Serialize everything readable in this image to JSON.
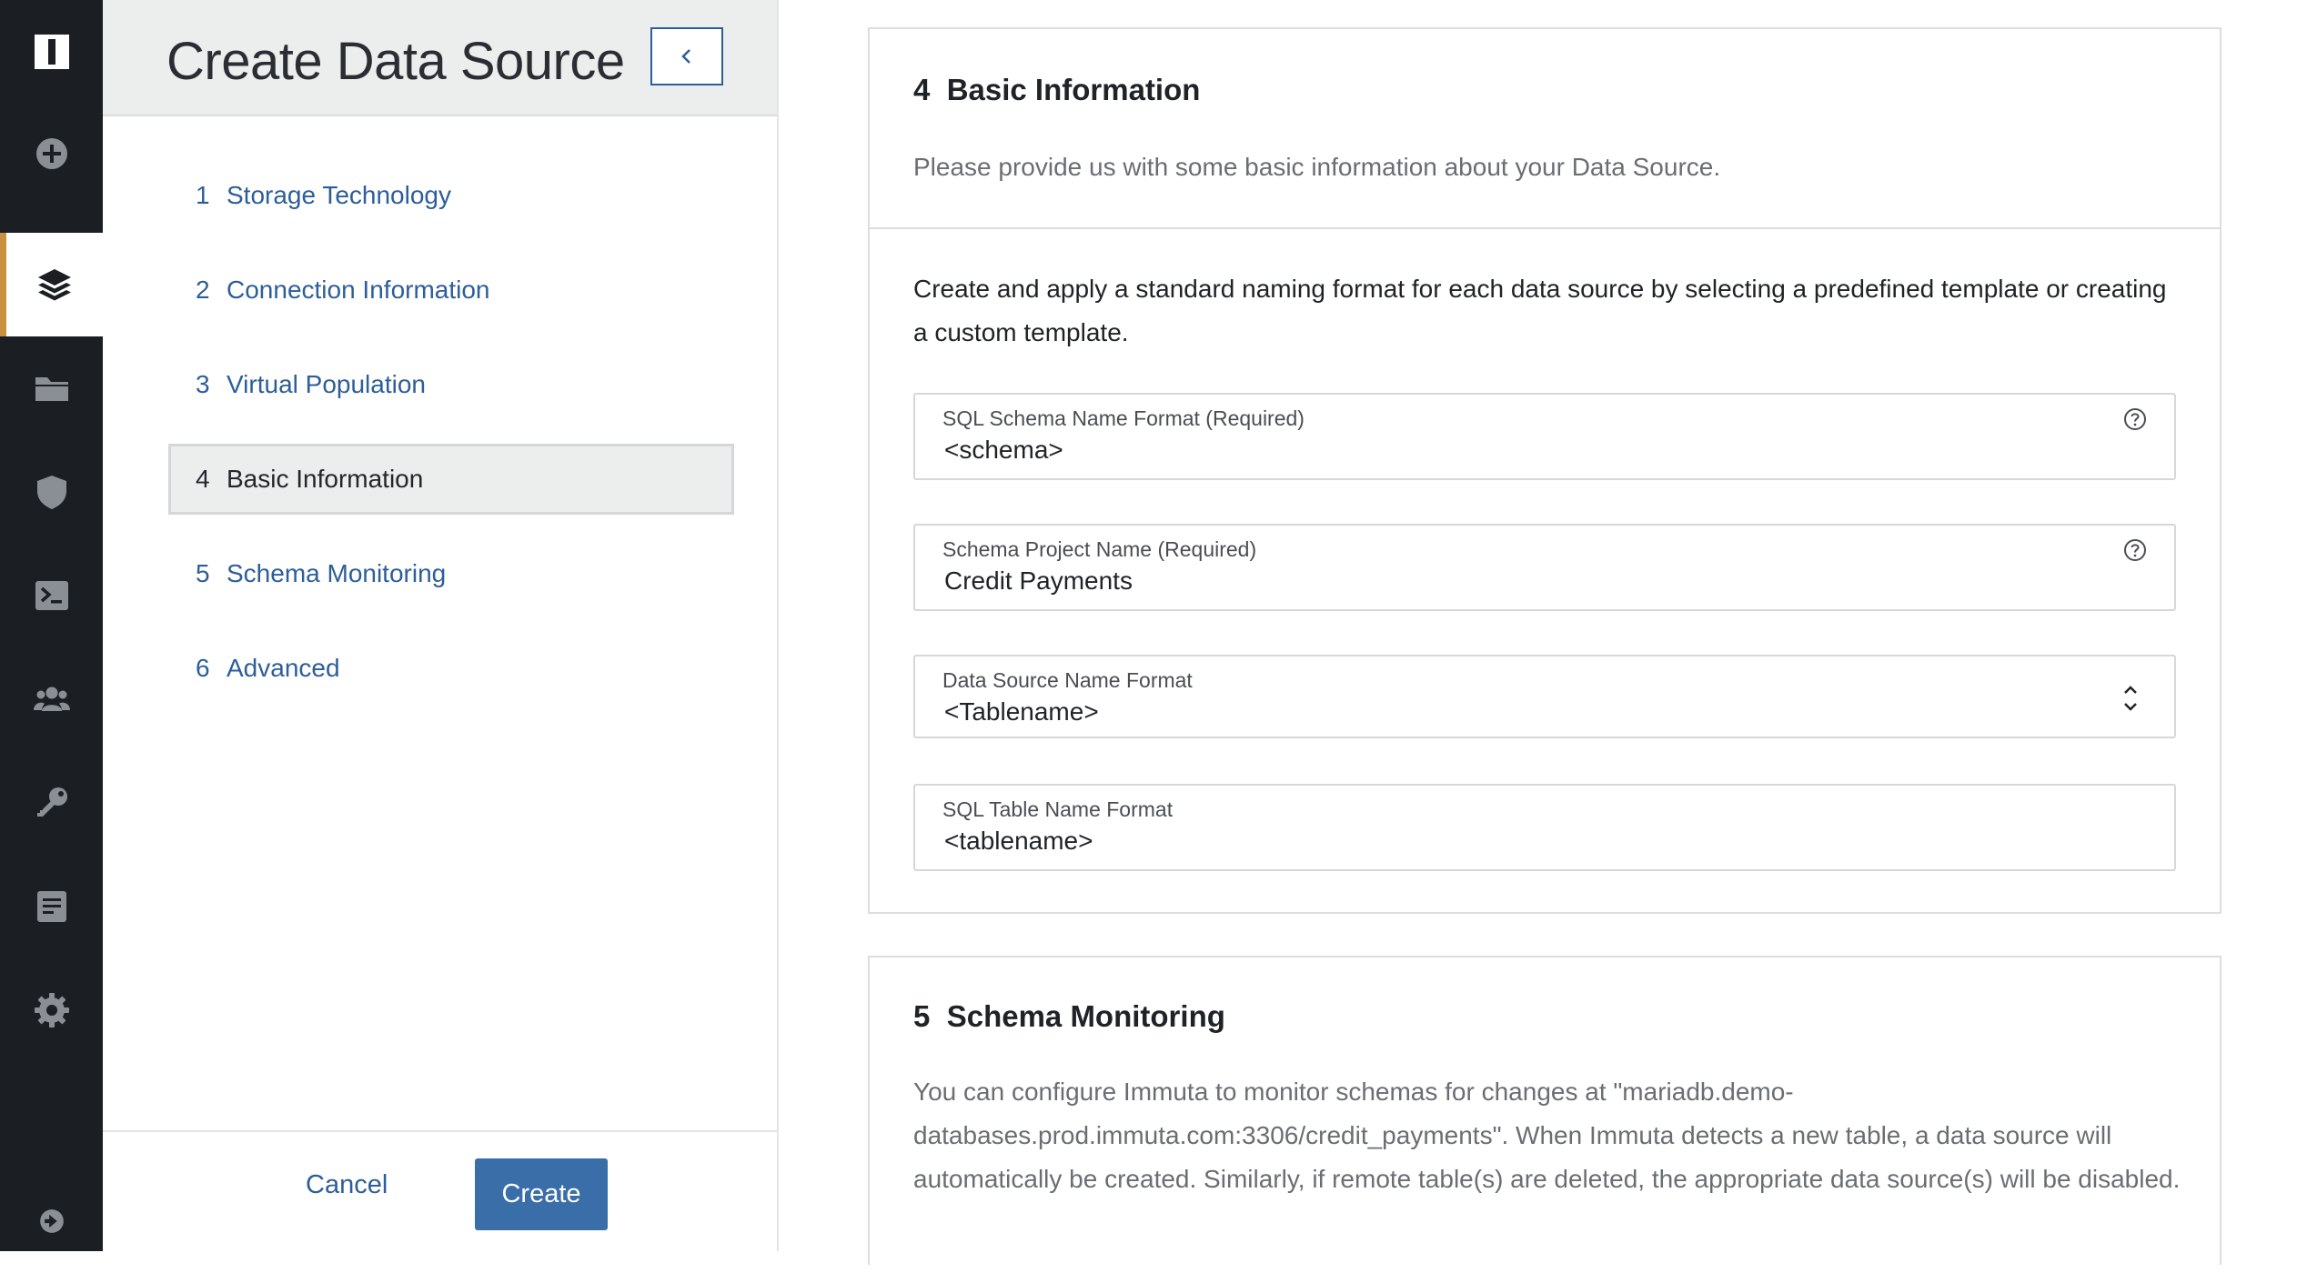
{
  "rail": {
    "items": [
      {
        "icon": "logo-icon",
        "active": false
      },
      {
        "icon": "plus-circle-icon",
        "active": false
      },
      {
        "icon": "layers-icon",
        "active": true
      },
      {
        "icon": "folder-icon",
        "active": false
      },
      {
        "icon": "shield-icon",
        "active": false
      },
      {
        "icon": "terminal-icon",
        "active": false
      },
      {
        "icon": "users-icon",
        "active": false
      },
      {
        "icon": "key-icon",
        "active": false
      },
      {
        "icon": "document-icon",
        "active": false
      },
      {
        "icon": "gear-icon",
        "active": false
      },
      {
        "icon": "arrow-circle-right-icon",
        "active": false
      }
    ],
    "active_accent": "#c9913f"
  },
  "panel": {
    "title": "Create Data Source",
    "collapse_icon": "chevron-left-icon",
    "steps": [
      {
        "num": "1",
        "label": "Storage Technology",
        "active": false
      },
      {
        "num": "2",
        "label": "Connection Information",
        "active": false
      },
      {
        "num": "3",
        "label": "Virtual Population",
        "active": false
      },
      {
        "num": "4",
        "label": "Basic Information",
        "active": true
      },
      {
        "num": "5",
        "label": "Schema Monitoring",
        "active": false
      },
      {
        "num": "6",
        "label": "Advanced",
        "active": false
      }
    ],
    "cancel_label": "Cancel",
    "create_label": "Create"
  },
  "basic_info": {
    "num": "4",
    "title": "Basic Information",
    "description": "Please provide us with some basic information about your Data Source.",
    "naming_text": "Create and apply a standard naming format for each data source by selecting a predefined template or creating a custom template.",
    "fields": [
      {
        "label": "SQL Schema Name Format (Required)",
        "value": "<schema>",
        "help": true
      },
      {
        "label": "Schema Project Name (Required)",
        "value": "Credit Payments",
        "help": true
      },
      {
        "label": "Data Source Name Format",
        "value": "<Tablename>",
        "select": true
      },
      {
        "label": "SQL Table Name Format",
        "value": "<tablename>"
      }
    ]
  },
  "schema_monitoring": {
    "num": "5",
    "title": "Schema Monitoring",
    "description": "You can configure Immuta to monitor schemas for changes at \"mariadb.demo-databases.prod.immuta.com:3306/credit_payments\". When Immuta detects a new table, a data source will automatically be created. Similarly, if remote table(s) are deleted, the appropriate data source(s) will be disabled."
  },
  "colors": {
    "link": "#2d5e99",
    "primary_button": "#3a6ea8",
    "rail_bg": "#1b1f23"
  }
}
